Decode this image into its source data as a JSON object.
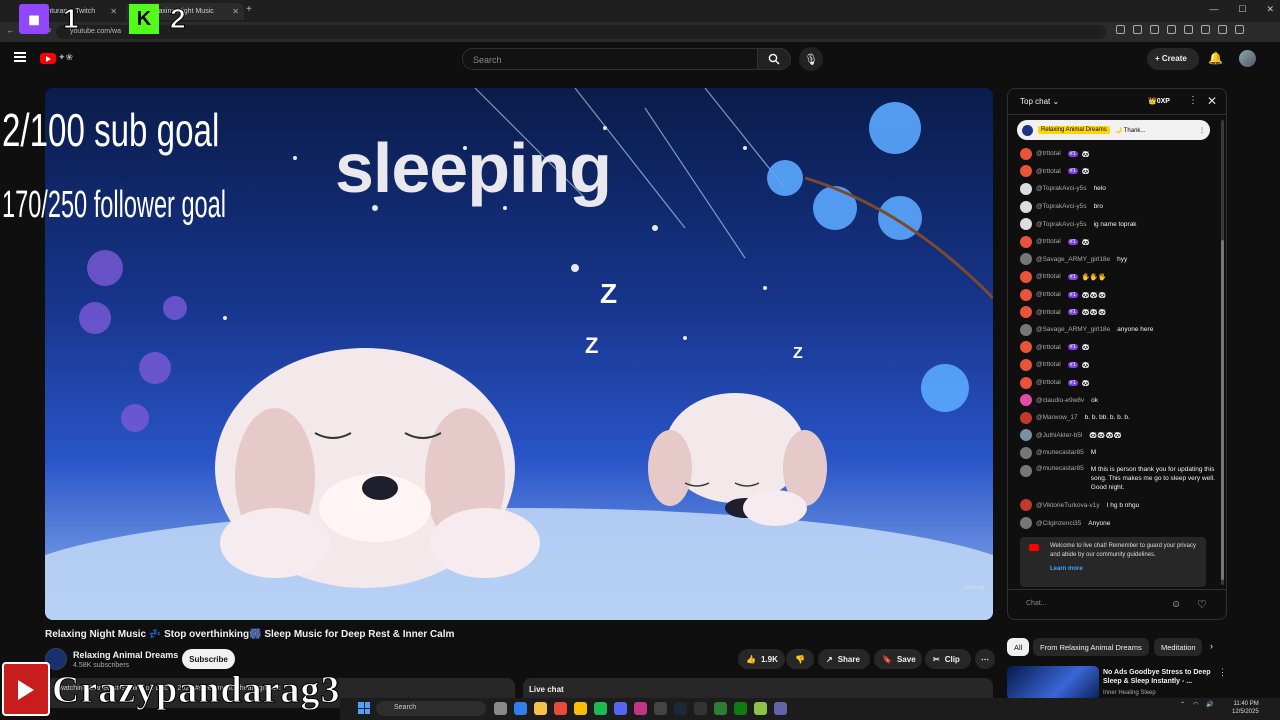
{
  "browser": {
    "tabs": [
      {
        "label": "yourpanturary - Twitch"
      },
      {
        "label": "Relaxing Night Music"
      }
    ],
    "url": "youtube.com/wa"
  },
  "overlay": {
    "num1": "1",
    "num2": "2",
    "sub_goal": "2/100 sub goal",
    "follower_goal": "170/250 follower goal",
    "streamer_name": "Crazypandarag3"
  },
  "header": {
    "search_placeholder": "Search",
    "create_label": "Create"
  },
  "video": {
    "overlay_text": "sleeping",
    "watermark": "Relaxing",
    "title": "Relaxing Night Music 💤 Stop overthinking🎆 Sleep Music for Deep Rest & Inner Calm",
    "channel": "Relaxing Animal Dreams",
    "subscribers": "4.58K subscribers",
    "subscribe_label": "Subscribe",
    "likes": "1.9K",
    "share_label": "Share",
    "save_label": "Save",
    "clip_label": "Clip",
    "description": "6 watching  Started streaming on Dec 5, 2025  #sleepmusic #healingmusic",
    "live_chat_label": "Live chat"
  },
  "chat": {
    "header": "Top chat",
    "xp": "0XP",
    "pinned_name": "Relaxing Animal Dreams",
    "pinned_text": "🌙 Thank...",
    "messages": [
      {
        "author": "@trttotal",
        "badge": "#1",
        "text": "🐼",
        "av": "o"
      },
      {
        "author": "@trttotal",
        "badge": "#1",
        "text": "🐼",
        "av": "o"
      },
      {
        "author": "@ToprakAvci-y5s",
        "badge": "",
        "text": "helo",
        "av": "w"
      },
      {
        "author": "@ToprakAvci-y5s",
        "badge": "",
        "text": "bro",
        "av": "w"
      },
      {
        "author": "@ToprakAvci-y5s",
        "badge": "",
        "text": "ig name toprak",
        "av": "w"
      },
      {
        "author": "@trttotal",
        "badge": "#1",
        "text": "🐼",
        "av": "o"
      },
      {
        "author": "@Savage_ARMY_girl18e",
        "badge": "",
        "text": "hyy",
        "av": "g"
      },
      {
        "author": "@trttotal",
        "badge": "#1",
        "text": "🖐🖐🖐",
        "av": "o"
      },
      {
        "author": "@trttotal",
        "badge": "#1",
        "text": "🐼🐼🐼",
        "av": "o"
      },
      {
        "author": "@trttotal",
        "badge": "#1",
        "text": "🐼🐼🐼",
        "av": "o"
      },
      {
        "author": "@Savage_ARMY_girl18e",
        "badge": "",
        "text": "anyone here",
        "av": "g"
      },
      {
        "author": "@trttotal",
        "badge": "#1",
        "text": "🐼",
        "av": "o"
      },
      {
        "author": "@trttotal",
        "badge": "#1",
        "text": "🐼",
        "av": "o"
      },
      {
        "author": "@trttotal",
        "badge": "#1",
        "text": "🐼",
        "av": "o"
      },
      {
        "author": "@claudio-e9w8v",
        "badge": "",
        "text": "ok",
        "av": "p"
      },
      {
        "author": "@Marwow_17",
        "badge": "",
        "text": "b. b. bb. b. b. b.",
        "av": "r"
      },
      {
        "author": "@JuthiAkter-b5l",
        "badge": "",
        "text": "🐼🐼🐼🐼",
        "av": "b"
      },
      {
        "author": "@munecastar85",
        "badge": "",
        "text": "M",
        "av": "g"
      },
      {
        "author": "@munecastar85",
        "badge": "",
        "text": "M this is person thank you for updating this song. This makes me go to sleep very well. Good night.",
        "av": "g",
        "tall": true
      },
      {
        "author": "@ViktorieTurkova-v1y",
        "badge": "",
        "text": "I hg b nhgu",
        "av": "r"
      },
      {
        "author": "@Cilginzenci35",
        "badge": "",
        "text": "Anyone",
        "av": "g"
      }
    ],
    "welcome_text": "Welcome to live chat! Remember to guard your privacy and abide by our community guidelines.",
    "learn_more": "Learn more",
    "input_placeholder": "Chat..."
  },
  "chips": [
    "All",
    "From Relaxing Animal Dreams",
    "Meditation"
  ],
  "recommendation": {
    "title": "No Ads Goodbye Stress to Deep Sleep & Sleep Instantly - ...",
    "channel": "Inner Healing Sleep"
  },
  "taskbar": {
    "search_label": "Search",
    "time": "11:40 PM",
    "date": "12/5/2025"
  },
  "colors": {
    "youtube_red": "#ff0000",
    "twitch_purple": "#9146ff",
    "kick_green": "#53fc18",
    "link_blue": "#3ea6ff"
  }
}
